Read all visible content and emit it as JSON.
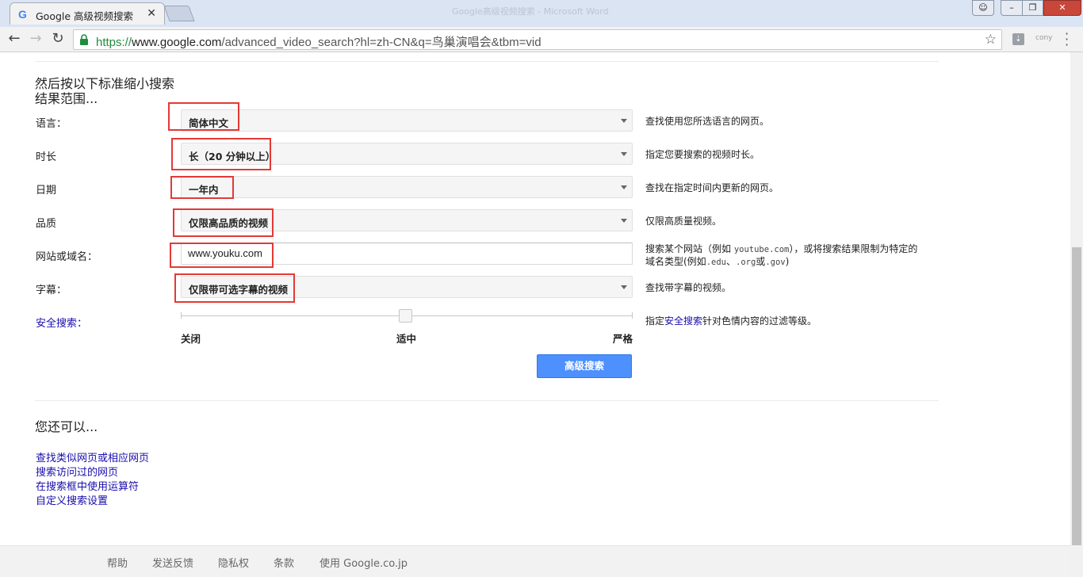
{
  "browser": {
    "tab_title": "Google 高级视频搜索",
    "tab_favicon": "G",
    "tab_close": "✕",
    "titlebar_ghost": "Google高级视频搜索 - Microsoft Word",
    "url_scheme": "https://",
    "url_host": "www.google.com",
    "url_rest": "/advanced_video_search?hl=zh-CN&q=鸟巢演唱会&tbm=vid",
    "ext_label": "cony"
  },
  "narrow": {
    "heading_line1": "然后按以下标准缩小搜索",
    "heading_line2": "结果范围..."
  },
  "rows": {
    "language": {
      "label": "语言：",
      "value": "简体中文",
      "hint": "查找使用您所选语言的网页。"
    },
    "duration": {
      "label": "时长",
      "value": "长（20 分钟以上）",
      "hint": "指定您要搜索的视频时长。"
    },
    "date": {
      "label": "日期",
      "value": "一年内",
      "hint": "查找在指定时间内更新的网页。"
    },
    "quality": {
      "label": "品质",
      "value": "仅限高品质的视频",
      "hint": "仅限高质量视频。"
    },
    "site": {
      "label": "网站或域名：",
      "value": "www.youku.com",
      "hint_a": "搜索某个网站（例如 ",
      "hint_code1": "youtube.com",
      "hint_b": "），或将搜索结果限制为特定的",
      "hint_c": "域名类型(例如",
      "hint_code2": ".edu",
      "hint_d": "、",
      "hint_code3": ".org",
      "hint_e": "或",
      "hint_code4": ".gov",
      "hint_f": ")"
    },
    "subtitles": {
      "label": "字幕：",
      "value": "仅限带可选字幕的视频",
      "hint": "查找带字幕的视频。"
    },
    "safesearch": {
      "label": "安全搜索：",
      "level_off": "关闭",
      "level_mid": "适中",
      "level_strict": "严格",
      "selected": "适中",
      "hint_a": "指定",
      "hint_link": "安全搜索",
      "hint_b": "针对色情内容的过滤等级。"
    }
  },
  "search_button": "高级搜索",
  "more": {
    "heading": "您还可以...",
    "links": [
      "查找类似网页或相应网页",
      "搜索访问过的网页",
      "在搜索框中使用运算符",
      "自定义搜索设置"
    ]
  },
  "footer": [
    "帮助",
    "发送反馈",
    "隐私权",
    "条款",
    "使用 Google.co.jp"
  ]
}
